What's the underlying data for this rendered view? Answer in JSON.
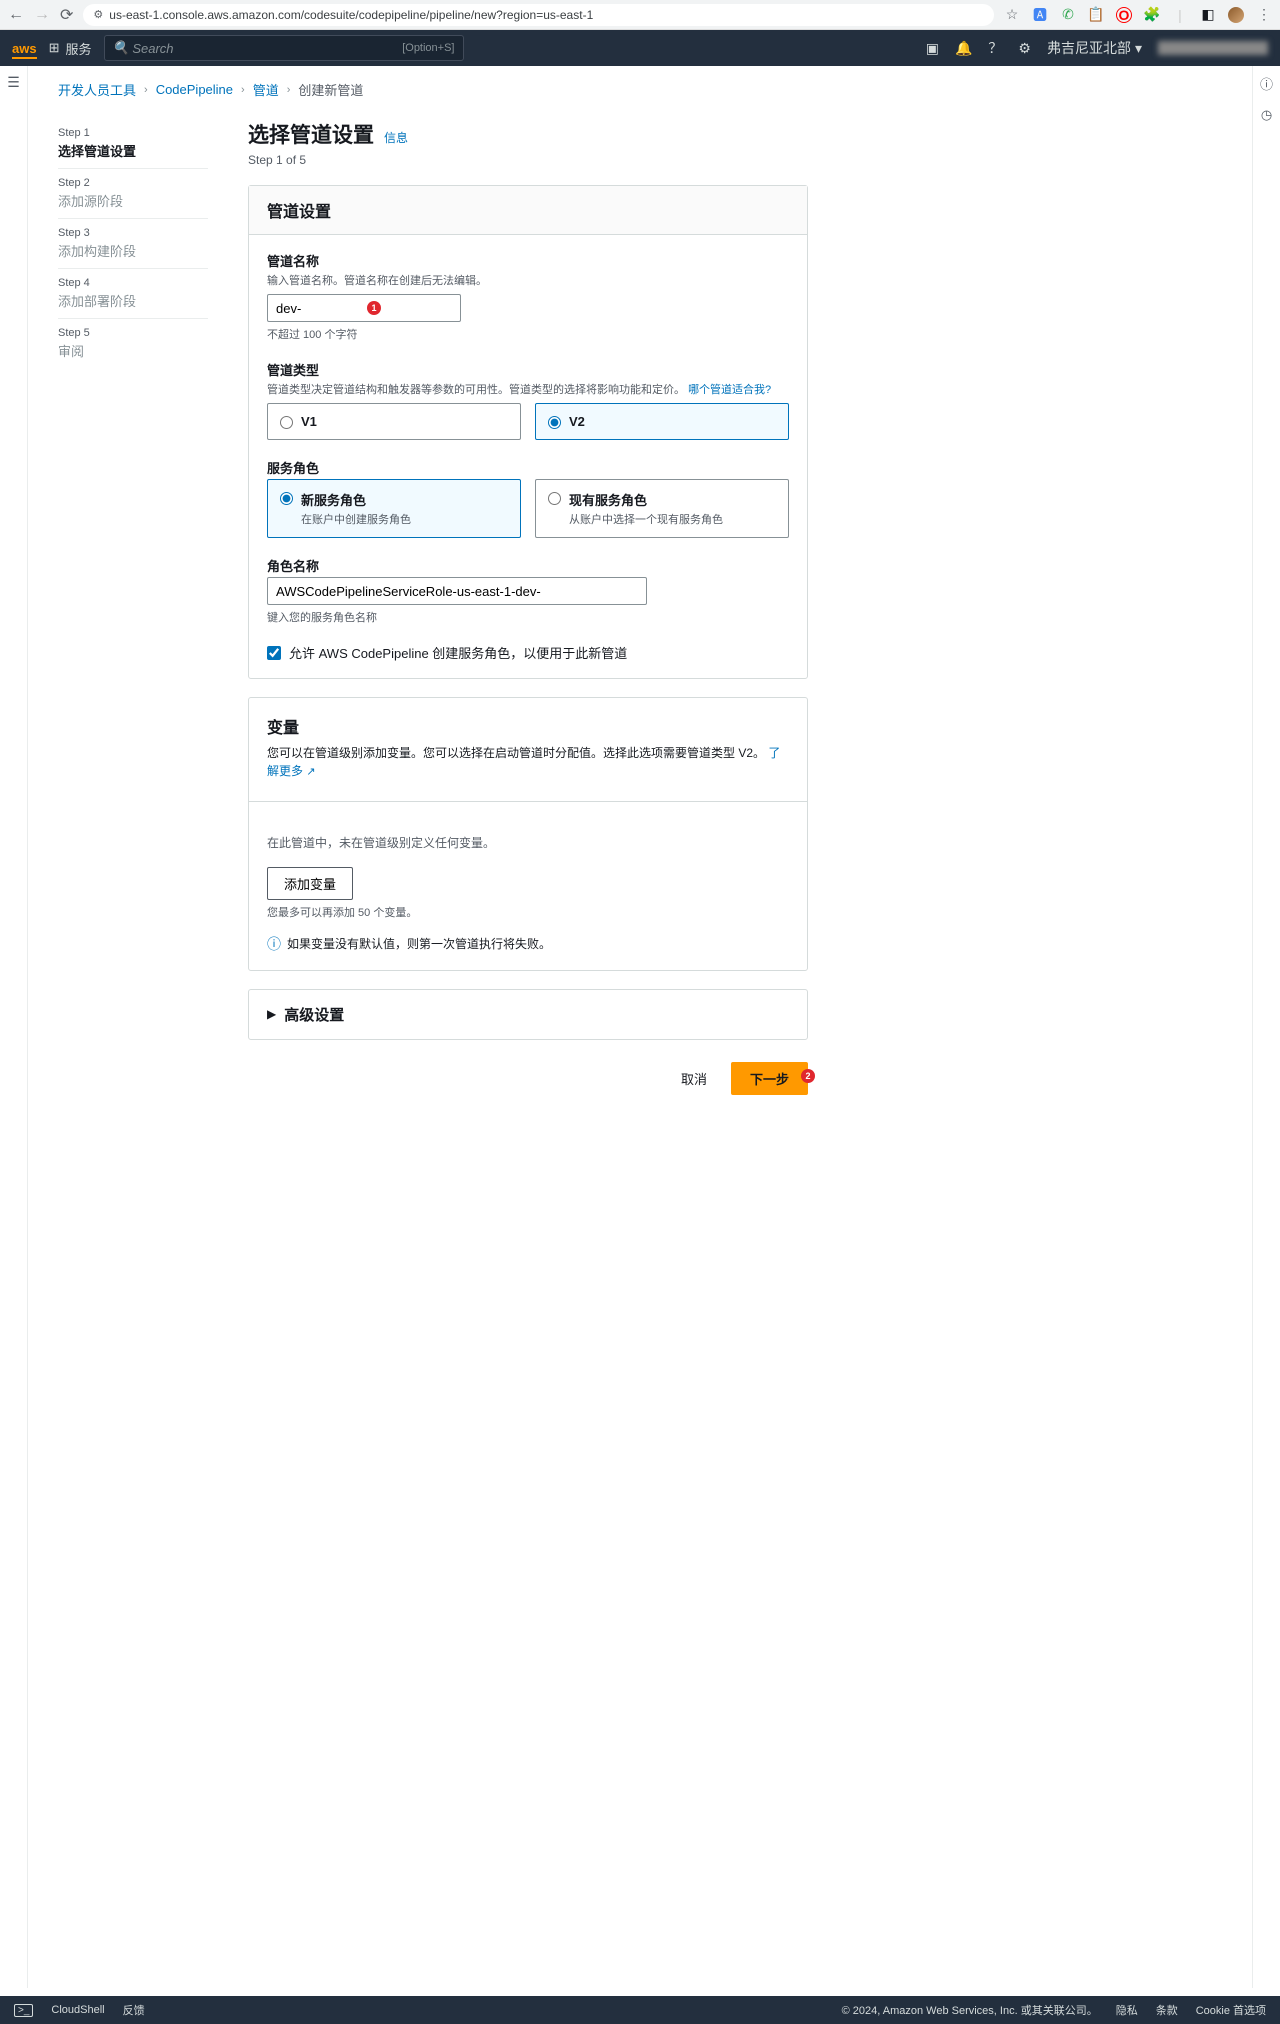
{
  "browser": {
    "url": "us-east-1.console.aws.amazon.com/codesuite/codepipeline/pipeline/new?region=us-east-1"
  },
  "nav": {
    "logo": "aws",
    "services": "服务",
    "search_placeholder": "Search",
    "search_kbd": "[Option+S]",
    "region": "弗吉尼亚北部"
  },
  "breadcrumb": {
    "items": [
      "开发人员工具",
      "CodePipeline",
      "管道",
      "创建新管道"
    ]
  },
  "steps": [
    {
      "label": "Step 1",
      "name": "选择管道设置"
    },
    {
      "label": "Step 2",
      "name": "添加源阶段"
    },
    {
      "label": "Step 3",
      "name": "添加构建阶段"
    },
    {
      "label": "Step 4",
      "name": "添加部署阶段"
    },
    {
      "label": "Step 5",
      "name": "审阅"
    }
  ],
  "page": {
    "title": "选择管道设置",
    "info": "信息",
    "counter": "Step 1 of 5"
  },
  "settings": {
    "header": "管道设置",
    "name_label": "管道名称",
    "name_desc": "输入管道名称。管道名称在创建后无法编辑。",
    "name_value": "dev-",
    "name_hint": "不超过 100 个字符",
    "type_label": "管道类型",
    "type_desc_prefix": "管道类型决定管道结构和触发器等参数的可用性。管道类型的选择将影响功能和定价。",
    "type_link": "哪个管道适合我?",
    "v1": "V1",
    "v2": "V2",
    "role_label": "服务角色",
    "role_new_title": "新服务角色",
    "role_new_desc": "在账户中创建服务角色",
    "role_existing_title": "现有服务角色",
    "role_existing_desc": "从账户中选择一个现有服务角色",
    "rolename_label": "角色名称",
    "rolename_value": "AWSCodePipelineServiceRole-us-east-1-dev-",
    "rolename_hint": "键入您的服务角色名称",
    "allow_label": "允许 AWS CodePipeline 创建服务角色，以便用于此新管道"
  },
  "vars": {
    "header": "变量",
    "desc": "您可以在管道级别添加变量。您可以选择在启动管道时分配值。选择此选项需要管道类型 V2。",
    "learn_more": "了解更多",
    "empty": "在此管道中，未在管道级别定义任何变量。",
    "add_btn": "添加变量",
    "limit": "您最多可以再添加 50 个变量。",
    "warn": "如果变量没有默认值，则第一次管道执行将失败。"
  },
  "advanced": {
    "title": "高级设置"
  },
  "actions": {
    "cancel": "取消",
    "next": "下一步"
  },
  "footer": {
    "cloudshell": "CloudShell",
    "feedback": "反馈",
    "copyright": "© 2024, Amazon Web Services, Inc. 或其关联公司。",
    "privacy": "隐私",
    "terms": "条款",
    "cookie": "Cookie 首选项"
  }
}
